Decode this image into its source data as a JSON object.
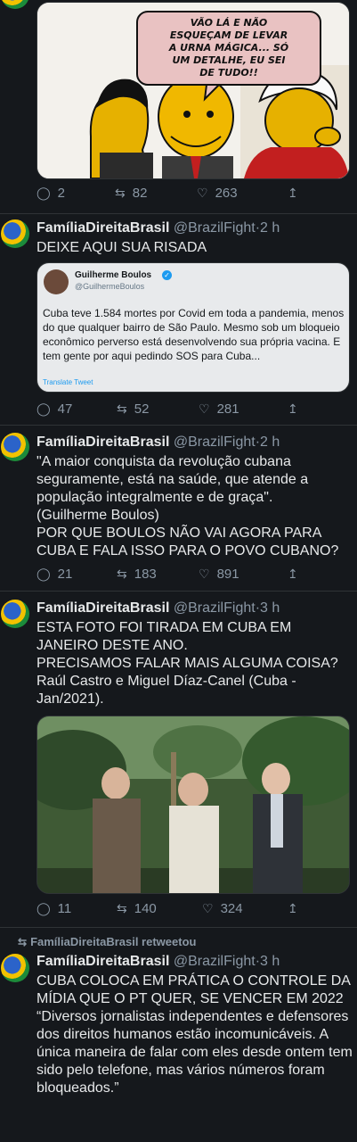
{
  "cartoon": {
    "speech": "VÃO LÁ E NÃO\nESQUEÇAM DE LEVAR\nA URNA MÁGICA... SÓ\nUM DETALHE, EU SEI\nDE TUDO!!",
    "stats": {
      "replies": "2",
      "retweets": "82",
      "likes": "263"
    }
  },
  "tweets": [
    {
      "name": "FamíliaDireitaBrasil",
      "handle": "@BrazilFight",
      "sep": "·",
      "time": "2 h",
      "text": "DEIXE AQUI SUA RISADA",
      "quote": {
        "name": "Guilherme Boulos",
        "handle": "@GuilhermeBoulos",
        "text": "Cuba teve 1.584 mortes por Covid em toda a pandemia, menos do que qualquer bairro de São Paulo. Mesmo sob um bloqueio econômico perverso está desenvolvendo sua própria vacina. E tem gente por aqui pedindo SOS para Cuba...",
        "translate": "Translate Tweet"
      },
      "stats": {
        "replies": "47",
        "retweets": "52",
        "likes": "281"
      }
    },
    {
      "name": "FamíliaDireitaBrasil",
      "handle": "@BrazilFight",
      "sep": "·",
      "time": "2 h",
      "text": "\"A maior conquista da revolução cubana seguramente, está na saúde, que atende a população integralmente e de graça\".\n(Guilherme Boulos)\nPOR QUE BOULOS NÃO VAI AGORA PARA CUBA E FALA ISSO PARA O POVO CUBANO?",
      "stats": {
        "replies": "21",
        "retweets": "183",
        "likes": "891"
      }
    },
    {
      "name": "FamíliaDireitaBrasil",
      "handle": "@BrazilFight",
      "sep": "·",
      "time": "3 h",
      "text": "ESTA FOTO FOI TIRADA EM CUBA EM JANEIRO DESTE ANO.\nPRECISAMOS FALAR MAIS ALGUMA COISA?\nRaúl Castro e Miguel Díaz-Canel (Cuba - Jan/2021).",
      "stats": {
        "replies": "11",
        "retweets": "140",
        "likes": "324"
      }
    },
    {
      "retweeted_by": "FamíliaDireitaBrasil retweetou",
      "name": "FamíliaDireitaBrasil",
      "handle": "@BrazilFight",
      "sep": "·",
      "time": "3 h",
      "text": "CUBA COLOCA EM PRÁTICA O CONTROLE DA MÍDIA QUE O PT QUER, SE VENCER EM 2022\n“Diversos jornalistas independentes e defensores dos direitos humanos estão incomunicáveis. A única maneira de falar com eles desde ontem tem sido pelo telefone, mas vários números foram bloqueados.”"
    }
  ],
  "icons": {
    "reply": "reply-icon",
    "retweet": "retweet-icon",
    "like": "heart-icon",
    "share": "share-icon"
  },
  "colors": {
    "background": "#15181c",
    "text": "#e7e9ea",
    "muted": "#8b98a5",
    "divider": "#2f3336",
    "verified": "#1d9bf0"
  }
}
